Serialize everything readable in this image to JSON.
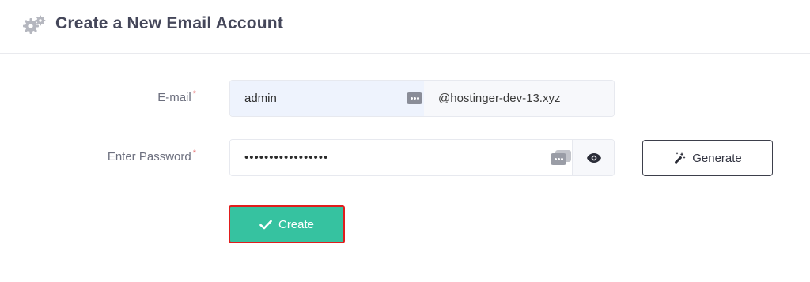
{
  "header": {
    "icon": "gears-icon",
    "title": "Create a New Email Account"
  },
  "form": {
    "email": {
      "label": "E-mail",
      "required_mark": "*",
      "value": "admin",
      "domain": "@hostinger-dev-13.xyz"
    },
    "password": {
      "label": "Enter Password",
      "required_mark": "*",
      "value": "•••••••••••••••••",
      "visibility_icon": "eye-icon"
    },
    "generate_label": "Generate",
    "generate_icon": "magic-wand-icon",
    "create_label": "Create",
    "create_icon": "checkmark-icon"
  },
  "colors": {
    "accent": "#36c2a0",
    "highlight_border": "#e11d1d",
    "required": "#e57373"
  }
}
